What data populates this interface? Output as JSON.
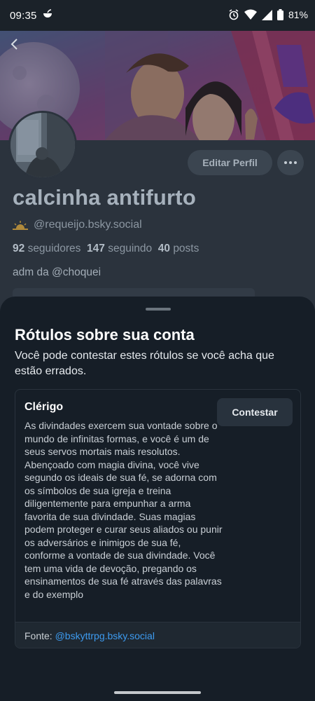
{
  "status_bar": {
    "time": "09:35",
    "battery": "81%"
  },
  "profile": {
    "edit_button": "Editar Perfil",
    "display_name": "calcinha antifurto",
    "handle": "@requeijo.bsky.social",
    "followers_count": "92",
    "followers_label": "seguidores",
    "following_count": "147",
    "following_label": "seguindo",
    "posts_count": "40",
    "posts_label": "posts",
    "bio": "adm da @choquei"
  },
  "sheet": {
    "title": "Rótulos sobre sua conta",
    "description": "Você pode contestar estes rótulos se você acha que estão errados.",
    "label": {
      "name": "Clérigo",
      "description": "As divindades exercem sua vontade sobre o mundo de infinitas formas, e você é um de seus servos mortais mais resolutos. Abençoado com magia divina, você vive segundo os ideais de sua fé, se adorna com os símbolos de sua igreja e treina diligentemente para empunhar a arma favorita de sua divindade. Suas magias podem proteger e curar seus aliados ou punir os adversários e inimigos de sua fé, conforme a vontade de sua divindade. Você tem uma vida de devoção, pregando os ensinamentos de sua fé através das palavras e do exemplo",
      "contest_button": "Contestar",
      "source_prefix": "Fonte:",
      "source_link": "@bskyttrpg.bsky.social"
    }
  },
  "colors": {
    "accent": "#3d9bf0",
    "sheet_bg": "#161e27",
    "page_bg": "#2a323c"
  }
}
